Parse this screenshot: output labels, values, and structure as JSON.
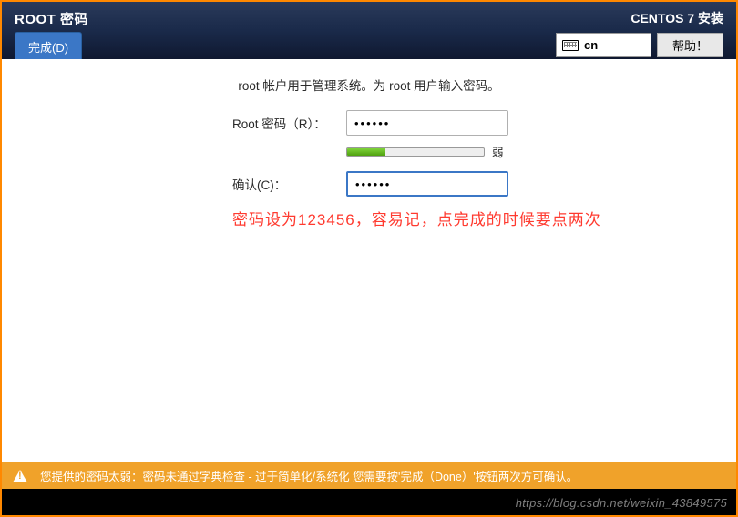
{
  "header": {
    "title": "ROOT 密码",
    "done_button": "完成(D)",
    "installer_title": "CENTOS 7 安装",
    "keyboard_layout": "cn",
    "help_button": "帮助！"
  },
  "form": {
    "instruction": "root 帐户用于管理系统。为 root 用户输入密码。",
    "root_password_label": "Root 密码（R）：",
    "root_password_value": "••••••",
    "confirm_label": "确认(C)：",
    "confirm_value": "••••••",
    "strength_text": "弱",
    "strength_percent": 28
  },
  "annotation": "密码设为123456，容易记，点完成的时候要点两次",
  "warning": {
    "text": "您提供的密码太弱：密码未通过字典检查 - 过于简单化/系统化 您需要按'完成（Done）'按钮两次方可确认。"
  },
  "watermark": "https://blog.csdn.net/weixin_43849575"
}
